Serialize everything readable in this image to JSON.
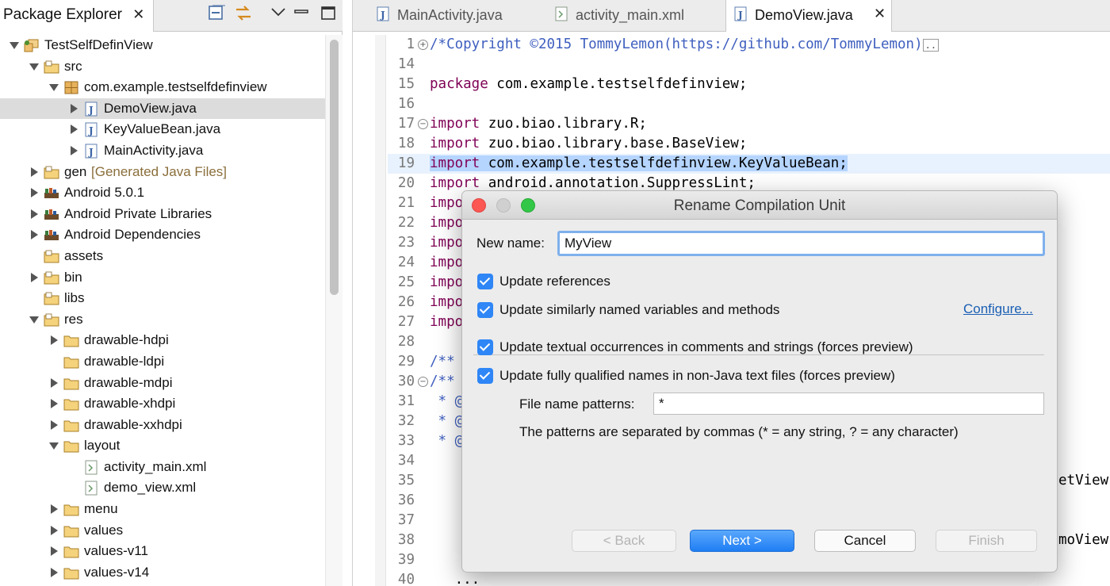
{
  "explorer": {
    "tab_label": "Package Explorer",
    "tree": [
      {
        "label": "TestSelfDefinView",
        "decor": "",
        "level": 0,
        "twisty": "expanded",
        "icon": "project-icon",
        "selected": false
      },
      {
        "label": "src",
        "decor": "",
        "level": 1,
        "twisty": "expanded",
        "icon": "source-folder-icon",
        "selected": false
      },
      {
        "label": "com.example.testselfdefinview",
        "decor": "",
        "level": 2,
        "twisty": "expanded",
        "icon": "package-icon",
        "selected": false
      },
      {
        "label": "DemoView.java",
        "decor": "",
        "level": 3,
        "twisty": "collapsed",
        "icon": "java-file-icon",
        "selected": true
      },
      {
        "label": "KeyValueBean.java",
        "decor": "",
        "level": 3,
        "twisty": "collapsed",
        "icon": "java-file-icon",
        "selected": false
      },
      {
        "label": "MainActivity.java",
        "decor": "",
        "level": 3,
        "twisty": "collapsed",
        "icon": "java-file-icon",
        "selected": false
      },
      {
        "label": "gen",
        "decor": "[Generated Java Files]",
        "level": 1,
        "twisty": "collapsed",
        "icon": "source-folder-icon",
        "selected": false
      },
      {
        "label": "Android 5.0.1",
        "decor": "",
        "level": 1,
        "twisty": "collapsed",
        "icon": "library-icon",
        "selected": false
      },
      {
        "label": "Android Private Libraries",
        "decor": "",
        "level": 1,
        "twisty": "collapsed",
        "icon": "library-icon",
        "selected": false
      },
      {
        "label": "Android Dependencies",
        "decor": "",
        "level": 1,
        "twisty": "collapsed",
        "icon": "library-icon",
        "selected": false
      },
      {
        "label": "assets",
        "decor": "",
        "level": 1,
        "twisty": "none",
        "icon": "source-folder-icon",
        "selected": false
      },
      {
        "label": "bin",
        "decor": "",
        "level": 1,
        "twisty": "collapsed",
        "icon": "source-folder-icon",
        "selected": false
      },
      {
        "label": "libs",
        "decor": "",
        "level": 1,
        "twisty": "none",
        "icon": "source-folder-icon",
        "selected": false
      },
      {
        "label": "res",
        "decor": "",
        "level": 1,
        "twisty": "expanded",
        "icon": "source-folder-icon",
        "selected": false
      },
      {
        "label": "drawable-hdpi",
        "decor": "",
        "level": 2,
        "twisty": "collapsed",
        "icon": "folder-icon",
        "selected": false
      },
      {
        "label": "drawable-ldpi",
        "decor": "",
        "level": 2,
        "twisty": "none",
        "icon": "folder-icon",
        "selected": false
      },
      {
        "label": "drawable-mdpi",
        "decor": "",
        "level": 2,
        "twisty": "collapsed",
        "icon": "folder-icon",
        "selected": false
      },
      {
        "label": "drawable-xhdpi",
        "decor": "",
        "level": 2,
        "twisty": "collapsed",
        "icon": "folder-icon",
        "selected": false
      },
      {
        "label": "drawable-xxhdpi",
        "decor": "",
        "level": 2,
        "twisty": "collapsed",
        "icon": "folder-icon",
        "selected": false
      },
      {
        "label": "layout",
        "decor": "",
        "level": 2,
        "twisty": "expanded",
        "icon": "folder-icon",
        "selected": false
      },
      {
        "label": "activity_main.xml",
        "decor": "",
        "level": 3,
        "twisty": "none",
        "icon": "xml-file-icon",
        "selected": false
      },
      {
        "label": "demo_view.xml",
        "decor": "",
        "level": 3,
        "twisty": "none",
        "icon": "xml-file-icon",
        "selected": false
      },
      {
        "label": "menu",
        "decor": "",
        "level": 2,
        "twisty": "collapsed",
        "icon": "folder-icon",
        "selected": false
      },
      {
        "label": "values",
        "decor": "",
        "level": 2,
        "twisty": "collapsed",
        "icon": "folder-icon",
        "selected": false
      },
      {
        "label": "values-v11",
        "decor": "",
        "level": 2,
        "twisty": "collapsed",
        "icon": "folder-icon",
        "selected": false
      },
      {
        "label": "values-v14",
        "decor": "",
        "level": 2,
        "twisty": "collapsed",
        "icon": "folder-icon",
        "selected": false
      }
    ]
  },
  "editor": {
    "tabs": [
      {
        "label": "MainActivity.java",
        "icon": "java-file-icon",
        "active": false
      },
      {
        "label": "activity_main.xml",
        "icon": "xml-file-icon",
        "active": false
      },
      {
        "label": "DemoView.java",
        "icon": "java-file-icon",
        "active": true
      }
    ],
    "lines": [
      {
        "num": "1",
        "fold": "+",
        "highlight": false,
        "tokens": [
          {
            "t": "/*Copyright ©2015 TommyLemon(https://github.com/TommyLemon)",
            "c": "cm"
          },
          {
            "t": "..",
            "c": "box"
          }
        ]
      },
      {
        "num": "14",
        "fold": "",
        "highlight": false,
        "tokens": []
      },
      {
        "num": "15",
        "fold": "",
        "highlight": false,
        "tokens": [
          {
            "t": "package",
            "c": "kw"
          },
          {
            "t": " com.example.testselfdefinview;",
            "c": ""
          }
        ]
      },
      {
        "num": "16",
        "fold": "",
        "highlight": false,
        "tokens": []
      },
      {
        "num": "17",
        "fold": "−",
        "highlight": false,
        "tokens": [
          {
            "t": "import",
            "c": "kw"
          },
          {
            "t": " zuo.biao.library.R;",
            "c": ""
          }
        ]
      },
      {
        "num": "18",
        "fold": "",
        "highlight": false,
        "tokens": [
          {
            "t": "import",
            "c": "kw"
          },
          {
            "t": " zuo.biao.library.base.BaseView;",
            "c": ""
          }
        ]
      },
      {
        "num": "19",
        "fold": "",
        "highlight": true,
        "tokens": [
          {
            "t": "import",
            "c": "kw sel"
          },
          {
            "t": " com.example.testselfdefinview.KeyValueBean;",
            "c": "sel"
          }
        ]
      },
      {
        "num": "20",
        "fold": "",
        "highlight": false,
        "tokens": [
          {
            "t": "import",
            "c": "kw"
          },
          {
            "t": " android.annotation.SuppressLint;",
            "c": ""
          }
        ]
      },
      {
        "num": "21",
        "fold": "",
        "highlight": false,
        "tokens": [
          {
            "t": "impo",
            "c": "kw"
          }
        ]
      },
      {
        "num": "22",
        "fold": "",
        "highlight": false,
        "tokens": [
          {
            "t": "impo",
            "c": "kw"
          }
        ]
      },
      {
        "num": "23",
        "fold": "",
        "highlight": false,
        "tokens": [
          {
            "t": "impo",
            "c": "kw"
          }
        ]
      },
      {
        "num": "24",
        "fold": "",
        "highlight": false,
        "tokens": [
          {
            "t": "impo",
            "c": "kw"
          }
        ]
      },
      {
        "num": "25",
        "fold": "",
        "highlight": false,
        "tokens": [
          {
            "t": "impo",
            "c": "kw"
          }
        ]
      },
      {
        "num": "26",
        "fold": "",
        "highlight": false,
        "tokens": [
          {
            "t": "impo",
            "c": "kw"
          }
        ]
      },
      {
        "num": "27",
        "fold": "",
        "highlight": false,
        "tokens": [
          {
            "t": "impo",
            "c": "kw"
          }
        ]
      },
      {
        "num": "28",
        "fold": "",
        "highlight": false,
        "tokens": []
      },
      {
        "num": "29",
        "fold": "",
        "highlight": false,
        "tokens": [
          {
            "t": "/**",
            "c": "cm"
          }
        ]
      },
      {
        "num": "30",
        "fold": "−",
        "highlight": false,
        "tokens": [
          {
            "t": "/**",
            "c": "cm"
          }
        ]
      },
      {
        "num": "31",
        "fold": "",
        "highlight": false,
        "tokens": [
          {
            "t": " * @",
            "c": "cm"
          }
        ]
      },
      {
        "num": "32",
        "fold": "",
        "highlight": false,
        "tokens": [
          {
            "t": " * @",
            "c": "cm"
          }
        ]
      },
      {
        "num": "33",
        "fold": "",
        "highlight": false,
        "tokens": [
          {
            "t": " * @",
            "c": "cm"
          }
        ]
      },
      {
        "num": "34",
        "fold": "",
        "highlight": false,
        "tokens": []
      },
      {
        "num": "35",
        "fold": "",
        "highlight": false,
        "tokens": []
      },
      {
        "num": "36",
        "fold": "",
        "highlight": false,
        "tokens": []
      },
      {
        "num": "37",
        "fold": "",
        "highlight": false,
        "tokens": []
      },
      {
        "num": "38",
        "fold": "",
        "highlight": false,
        "tokens": []
      },
      {
        "num": "39",
        "fold": "",
        "highlight": false,
        "tokens": []
      },
      {
        "num": "40",
        "fold": "",
        "highlight": false,
        "tokens": [
          {
            "t": "   ...",
            "c": ""
          }
        ]
      }
    ],
    "right_fragments": [
      {
        "line": "35",
        "text": "etView("
      },
      {
        "line": "38",
        "text": "moView."
      }
    ]
  },
  "dialog": {
    "title": "Rename Compilation Unit",
    "new_name_label": "New name:",
    "new_name_value": "MyView",
    "options": [
      {
        "label": "Update references",
        "checked": true
      },
      {
        "label": "Update similarly named variables and methods",
        "checked": true
      },
      {
        "label": "Update textual occurrences in comments and strings (forces preview)",
        "checked": true
      },
      {
        "label": "Update fully qualified names in non-Java text files (forces preview)",
        "checked": true
      }
    ],
    "configure_link": "Configure...",
    "file_patterns_label": "File name patterns:",
    "file_patterns_value": "*",
    "patterns_hint": "The patterns are separated by commas (* = any string, ? = any character)",
    "buttons": {
      "back": "< Back",
      "next": "Next >",
      "cancel": "Cancel",
      "finish": "Finish"
    }
  },
  "colors": {
    "keyword": "#7f0055",
    "comment": "#3f5fbf",
    "selection": "#b5d5ff",
    "primary_button": "#1f7ef4",
    "checkbox": "#2f86f6",
    "link": "#1a5fb4"
  }
}
